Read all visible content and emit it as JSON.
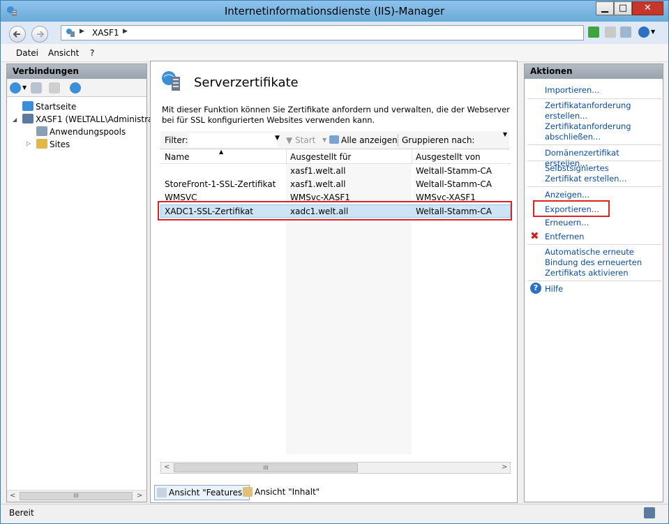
{
  "window": {
    "title": "Internetinformationsdienste (IIS)-Manager",
    "min_label": "▁",
    "max_label": "□",
    "close_label": "✕"
  },
  "addressbar": {
    "crumb": "XASF1",
    "sep1": "▶",
    "sep2": "▶"
  },
  "menu": {
    "file": "Datei",
    "view": "Ansicht",
    "help": "?"
  },
  "left": {
    "header": "Verbindungen",
    "tree": [
      {
        "label": "Startseite"
      },
      {
        "label": "XASF1 (WELTALL\\Administrat"
      },
      {
        "label": "Anwendungspools"
      },
      {
        "label": "Sites"
      }
    ],
    "scroll_grip": "III"
  },
  "center": {
    "title": "Serverzertifikate",
    "description": "Mit dieser Funktion können Sie Zertifikate anfordern und verwalten, die der Webserver bei für SSL konfigurierten Websites verwenden kann.",
    "filter_label": "Filter:",
    "start_label": "Start",
    "show_all_label": "Alle anzeigen",
    "group_label": "Gruppieren nach:",
    "columns": [
      "Name",
      "Ausgestellt für",
      "Ausgestellt von"
    ],
    "rows": [
      {
        "name": "",
        "issued_to": "xasf1.welt.all",
        "issued_by": "Weltall-Stamm-CA"
      },
      {
        "name": "StoreFront-1-SSL-Zertifikat",
        "issued_to": "xasf1.welt.all",
        "issued_by": "Weltall-Stamm-CA"
      },
      {
        "name": "WMSVC",
        "issued_to": "WMSvc-XASF1",
        "issued_by": "WMSvc-XASF1"
      },
      {
        "name": "XADC1-SSL-Zertifikat",
        "issued_to": "xadc1.welt.all",
        "issued_by": "Weltall-Stamm-CA"
      }
    ],
    "selected_row": 3,
    "scroll_grip": "III",
    "tab_features": "Ansicht \"Features\"",
    "tab_content": "Ansicht \"Inhalt\""
  },
  "right": {
    "header": "Aktionen",
    "actions": [
      {
        "label": "Importieren..."
      },
      {
        "label": "Zertifikatanforderung erstellen..."
      },
      {
        "label": "Zertifikatanforderung abschließen..."
      },
      {
        "label": "Domänenzertifikat erstellen..."
      },
      {
        "label": "Selbstsigniertes Zertifikat erstellen..."
      },
      {
        "label": "Anzeigen..."
      },
      {
        "label": "Exportieren..."
      },
      {
        "label": "Erneuern..."
      },
      {
        "label": "Entfernen"
      },
      {
        "label": "Automatische erneute Bindung des erneuerten Zertifikats aktivieren"
      },
      {
        "label": "Hilfe"
      }
    ],
    "remove_icon_glyph": "✖",
    "help_icon_glyph": "?"
  },
  "status": {
    "text": "Bereit"
  },
  "colors": {
    "accent_link": "#0b4da2",
    "selection": "#cde4f7",
    "highlight_box": "#dd2222",
    "titlebar": "#6aa9d8"
  }
}
